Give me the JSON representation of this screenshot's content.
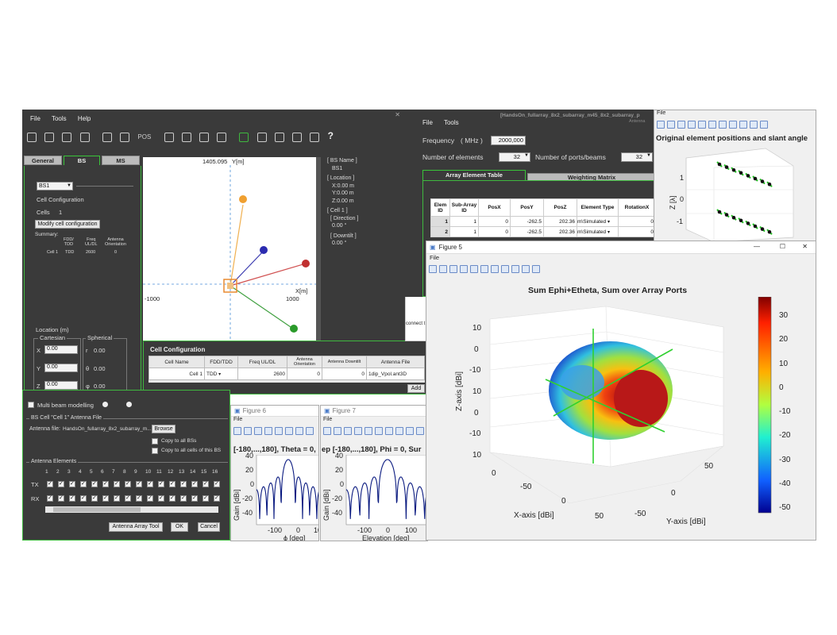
{
  "main_window": {
    "menu": [
      "File",
      "Tools",
      "Help"
    ],
    "toolbar_text": "POS",
    "tabs": [
      "General",
      "BS",
      "MS"
    ],
    "bs_select": "BS1",
    "cell_configuration_label": "Cell Configuration",
    "cells_label": "Cells",
    "cells_count": "1",
    "modify_button": "Modify cell configuration",
    "summary_label": "Summary:",
    "summary_headers": [
      "FDD/\nTDD",
      "Freq\nUL/DL",
      "Antenna\nOrientation"
    ],
    "summary_row": [
      "Cell 1",
      "TDD",
      "2600",
      "0"
    ],
    "location_label": "Location   (m)",
    "cartesian_label": "Cartesian",
    "spherical_label": "Spherical",
    "cart_fields": [
      {
        "label": "X",
        "value": "0.00"
      },
      {
        "label": "Y",
        "value": "0.00"
      },
      {
        "label": "Z",
        "value": "0.00"
      }
    ],
    "sph_fields": [
      {
        "label": "r",
        "value": "0.00"
      },
      {
        "label": "θ",
        "value": "0.00"
      },
      {
        "label": "φ",
        "value": "0.00"
      }
    ],
    "plot": {
      "top_value": "1405.095",
      "y_axis": "Y[m]",
      "x_axis": "X[m]",
      "x_min": "-1000",
      "x_max": "1000"
    },
    "info": [
      "[ BS Name ]",
      "BS1",
      "[ Location ]",
      "X:0.00  m",
      "Y:0.00  m",
      "Z:0.00  m",
      "[ Cell 1 ]",
      "[ Direction ]",
      "0.00 °",
      "[ Downtilt ]",
      "0.00 °"
    ]
  },
  "cell_config": {
    "title": "Cell Configuration",
    "headers": [
      "Cell Name",
      "FDD/TDD",
      "Freq UL/DL",
      "Antenna Orientation",
      "Antenna Downtilt",
      "Antenna File"
    ],
    "row": [
      "Cell 1",
      "TDD",
      "2600",
      "0",
      "0",
      "1dip_Vpol.ant3D"
    ],
    "add_button": "Add",
    "side_text": "connect t"
  },
  "antenna_panel": {
    "multi_beam": "Multi beam modelling",
    "file_group": "BS Cell \"Cell 1\" Antenna File",
    "antenna_file_label": "Antenna file:",
    "antenna_file_value": "HandsOn_fullarray_8x2_subarray_m...",
    "browse": "Browse",
    "copy_all_bs": "Copy to all BSs",
    "copy_all_cells": "Copy to all cells of this BS",
    "elements_group": "Antenna Elements",
    "element_numbers": [
      "1",
      "2",
      "3",
      "4",
      "5",
      "6",
      "7",
      "8",
      "9",
      "10",
      "11",
      "12",
      "13",
      "14",
      "15",
      "16"
    ],
    "tx": "TX",
    "rx": "RX",
    "tool_button": "Antenna Array Tool",
    "ok": "OK",
    "cancel": "Cancel"
  },
  "array_window": {
    "title": "[HandsOn_fullarray_8x2_subarray_m45_8x2_subarray_p",
    "subtitle": "Antenna",
    "menu": [
      "File",
      "Tools"
    ],
    "frequency_label": "Frequency",
    "mhz": "( MHz )",
    "frequency_value": "2000,000",
    "num_elements_label": "Number of elements",
    "num_elements_value": "32",
    "num_ports_label": "Number of ports/beams",
    "num_ports_value": "32",
    "tabs": [
      "Array Element Table",
      "Weighting Matrix"
    ],
    "table_headers": [
      "Elem ID",
      "Sub-Array ID",
      "PosX",
      "PosY",
      "PosZ",
      "Element Type",
      "RotationX"
    ],
    "rows": [
      [
        "1",
        "1",
        "0",
        "-262.5",
        "202.36",
        "m\\Simulated",
        "0"
      ],
      [
        "2",
        "1",
        "0",
        "-262.5",
        "202.36",
        "m\\Simulated",
        "0"
      ]
    ]
  },
  "fig_orig": {
    "menu": "File",
    "title": "Original element positions and slant angle",
    "zlabel": "Z [λ]",
    "ticks": [
      "1",
      "0",
      "-1"
    ]
  },
  "fig6": {
    "name": "Figure 6",
    "menu": "File",
    "title": "[-180,...,180], Theta = 0,",
    "ylabel": "Gain [dBi]",
    "xlabel": "ϕ [deg]",
    "yticks": [
      "40",
      "20",
      "0",
      "-20",
      "-40"
    ],
    "xticks": [
      "-100",
      "0",
      "10"
    ]
  },
  "fig7": {
    "name": "Figure 7",
    "menu": "File",
    "title": "ep [-180,...,180], Phi = 0, Sur",
    "ylabel": "Gain [dBi]",
    "xlabel": "Elevation [deg]",
    "yticks": [
      "40",
      "20",
      "0",
      "-20",
      "-40"
    ],
    "xticks": [
      "-100",
      "0",
      "100"
    ]
  },
  "fig5": {
    "name": "Figure 5",
    "menu": "File",
    "title": "Sum Ephi+Etheta, Sum over Array Ports",
    "zlabel": "Z-axis [dBi]",
    "xlabel": "X-axis [dBi]",
    "ylabel": "Y-axis [dBi]",
    "zticks": [
      "10",
      "0",
      "-10",
      "10",
      "0",
      "-10",
      "10"
    ],
    "xticks": [
      "0",
      "-50",
      "0",
      "50"
    ],
    "yticks": [
      "50",
      "0",
      "-50"
    ],
    "colorbar": [
      "30",
      "20",
      "10",
      "0",
      "-10",
      "-20",
      "-30",
      "-40",
      "-50"
    ],
    "window_controls": [
      "—",
      "☐",
      "✕"
    ]
  }
}
